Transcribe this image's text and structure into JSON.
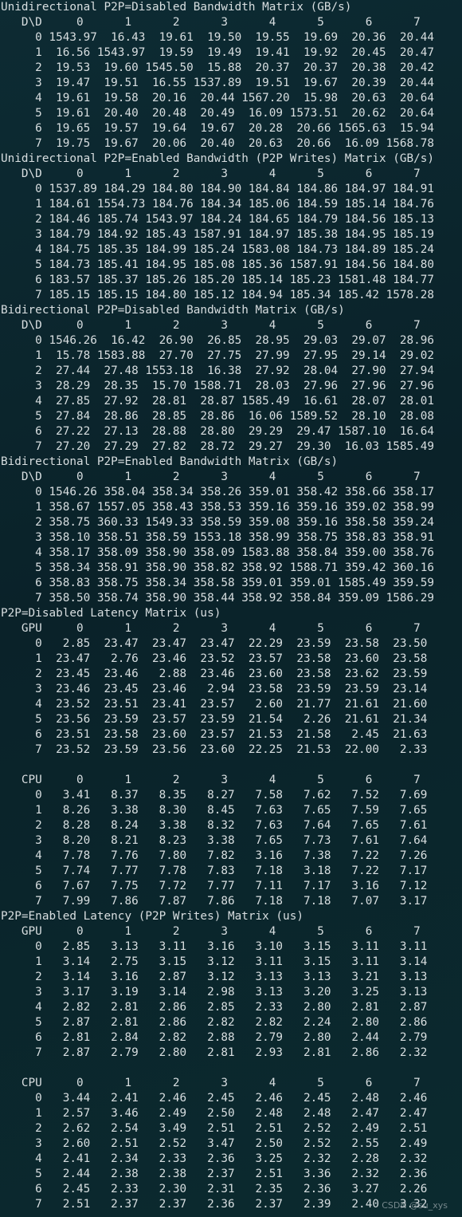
{
  "lines": [
    "Unidirectional P2P=Disabled Bandwidth Matrix (GB/s)",
    "   D\\D     0      1      2      3      4      5      6      7",
    "     0 1543.97  16.43  19.61  19.50  19.55  19.69  20.36  20.44",
    "     1  16.56 1543.97  19.59  19.49  19.41  19.92  20.45  20.47",
    "     2  19.53  19.60 1545.50  15.88  20.37  20.37  20.38  20.42",
    "     3  19.47  19.51  16.55 1537.89  19.51  19.67  20.39  20.44",
    "     4  19.61  19.58  20.16  20.44 1567.20  15.98  20.63  20.64",
    "     5  19.61  20.40  20.48  20.49  16.09 1573.51  20.62  20.64",
    "     6  19.65  19.57  19.64  19.67  20.28  20.66 1565.63  15.94",
    "     7  19.75  19.67  20.06  20.40  20.63  20.66  16.09 1568.78",
    "Unidirectional P2P=Enabled Bandwidth (P2P Writes) Matrix (GB/s)",
    "   D\\D     0      1      2      3      4      5      6      7",
    "     0 1537.89 184.29 184.80 184.90 184.84 184.86 184.97 184.91",
    "     1 184.61 1554.73 184.76 184.34 185.06 184.59 185.14 184.76",
    "     2 184.46 185.74 1543.97 184.24 184.65 184.79 184.56 185.13",
    "     3 184.79 184.92 185.43 1587.91 184.97 185.38 184.95 185.19",
    "     4 184.75 185.35 184.99 185.24 1583.08 184.73 184.89 185.24",
    "     5 184.73 185.41 184.95 185.08 185.36 1587.91 184.56 184.80",
    "     6 183.57 185.37 185.26 185.20 185.14 185.23 1581.48 184.77",
    "     7 185.15 185.15 184.80 185.12 184.94 185.34 185.42 1578.28",
    "Bidirectional P2P=Disabled Bandwidth Matrix (GB/s)",
    "   D\\D     0      1      2      3      4      5      6      7",
    "     0 1546.26  16.42  26.90  26.85  28.95  29.03  29.07  28.96",
    "     1  15.78 1583.88  27.70  27.75  27.99  27.95  29.14  29.02",
    "     2  27.44  27.48 1553.18  16.38  27.92  28.04  27.90  27.94",
    "     3  28.29  28.35  15.70 1588.71  28.03  27.96  27.96  27.96",
    "     4  27.85  27.92  28.81  28.87 1585.49  16.61  28.07  28.01",
    "     5  27.84  28.86  28.85  28.86  16.06 1589.52  28.10  28.08",
    "     6  27.22  27.13  28.88  28.80  29.29  29.47 1587.10  16.64",
    "     7  27.20  27.29  27.82  28.72  29.27  29.30  16.03 1585.49",
    "Bidirectional P2P=Enabled Bandwidth Matrix (GB/s)",
    "   D\\D     0      1      2      3      4      5      6      7",
    "     0 1546.26 358.04 358.34 358.26 359.01 358.42 358.66 358.17",
    "     1 358.67 1557.05 358.43 358.53 359.16 359.16 359.02 358.99",
    "     2 358.75 360.33 1549.33 358.59 359.08 359.16 358.58 359.24",
    "     3 358.10 358.51 358.59 1553.18 358.99 358.75 358.83 358.91",
    "     4 358.17 358.09 358.90 358.09 1583.88 358.84 359.00 358.76",
    "     5 358.34 358.91 358.90 358.82 358.92 1588.71 359.42 360.16",
    "     6 358.83 358.75 358.34 358.58 359.01 359.01 1585.49 359.59",
    "     7 358.50 358.74 358.90 358.44 358.92 358.84 359.09 1586.29",
    "P2P=Disabled Latency Matrix (us)",
    "   GPU     0      1      2      3      4      5      6      7",
    "     0   2.85  23.47  23.47  23.47  22.29  23.59  23.58  23.50",
    "     1  23.47   2.76  23.46  23.52  23.57  23.58  23.60  23.58",
    "     2  23.45  23.46   2.88  23.46  23.60  23.58  23.62  23.59",
    "     3  23.46  23.45  23.46   2.94  23.58  23.59  23.59  23.14",
    "     4  23.52  23.51  23.41  23.57   2.60  21.77  21.61  21.60",
    "     5  23.56  23.59  23.57  23.59  21.54   2.26  21.61  21.34",
    "     6  23.51  23.58  23.60  23.57  21.53  21.58   2.45  21.63",
    "     7  23.52  23.59  23.56  23.60  22.25  21.53  22.00   2.33",
    "",
    "   CPU     0      1      2      3      4      5      6      7",
    "     0   3.41   8.37   8.35   8.27   7.58   7.62   7.52   7.69",
    "     1   8.26   3.38   8.30   8.45   7.63   7.65   7.59   7.65",
    "     2   8.28   8.24   3.38   8.32   7.63   7.64   7.65   7.61",
    "     3   8.20   8.21   8.23   3.38   7.65   7.73   7.61   7.64",
    "     4   7.78   7.76   7.80   7.82   3.16   7.38   7.22   7.26",
    "     5   7.74   7.77   7.78   7.83   7.18   3.18   7.22   7.17",
    "     6   7.67   7.75   7.72   7.77   7.11   7.17   3.16   7.12",
    "     7   7.99   7.86   7.87   7.86   7.18   7.18   7.07   3.17",
    "P2P=Enabled Latency (P2P Writes) Matrix (us)",
    "   GPU     0      1      2      3      4      5      6      7",
    "     0   2.85   3.13   3.11   3.16   3.10   3.15   3.11   3.11",
    "     1   3.14   2.75   3.15   3.12   3.11   3.15   3.11   3.14",
    "     2   3.14   3.16   2.87   3.12   3.13   3.13   3.21   3.13",
    "     3   3.17   3.19   3.14   2.98   3.13   3.20   3.25   3.13",
    "     4   2.82   2.81   2.86   2.85   2.33   2.80   2.81   2.87",
    "     5   2.87   2.81   2.86   2.82   2.82   2.24   2.80   2.86",
    "     6   2.81   2.84   2.82   2.88   2.79   2.80   2.44   2.79",
    "     7   2.87   2.79   2.80   2.81   2.93   2.81   2.86   2.32",
    "",
    "   CPU     0      1      2      3      4      5      6      7",
    "     0   3.44   2.41   2.46   2.45   2.46   2.45   2.48   2.46",
    "     1   2.57   3.46   2.49   2.50   2.48   2.48   2.47   2.47",
    "     2   2.62   2.54   3.49   2.51   2.51   2.52   2.49   2.51",
    "     3   2.60   2.51   2.52   3.47   2.50   2.52   2.55   2.49",
    "     4   2.41   2.34   2.33   2.36   3.25   2.32   2.28   2.32",
    "     5   2.44   2.38   2.38   2.37   2.51   3.36   2.32   2.36",
    "     6   2.45   2.33   2.30   2.31   2.35   2.36   3.27   2.26",
    "     7   2.51   2.37   2.37   2.36   2.37   2.39   2.40   3.32"
  ],
  "watermark": "CSDN @su_xys"
}
